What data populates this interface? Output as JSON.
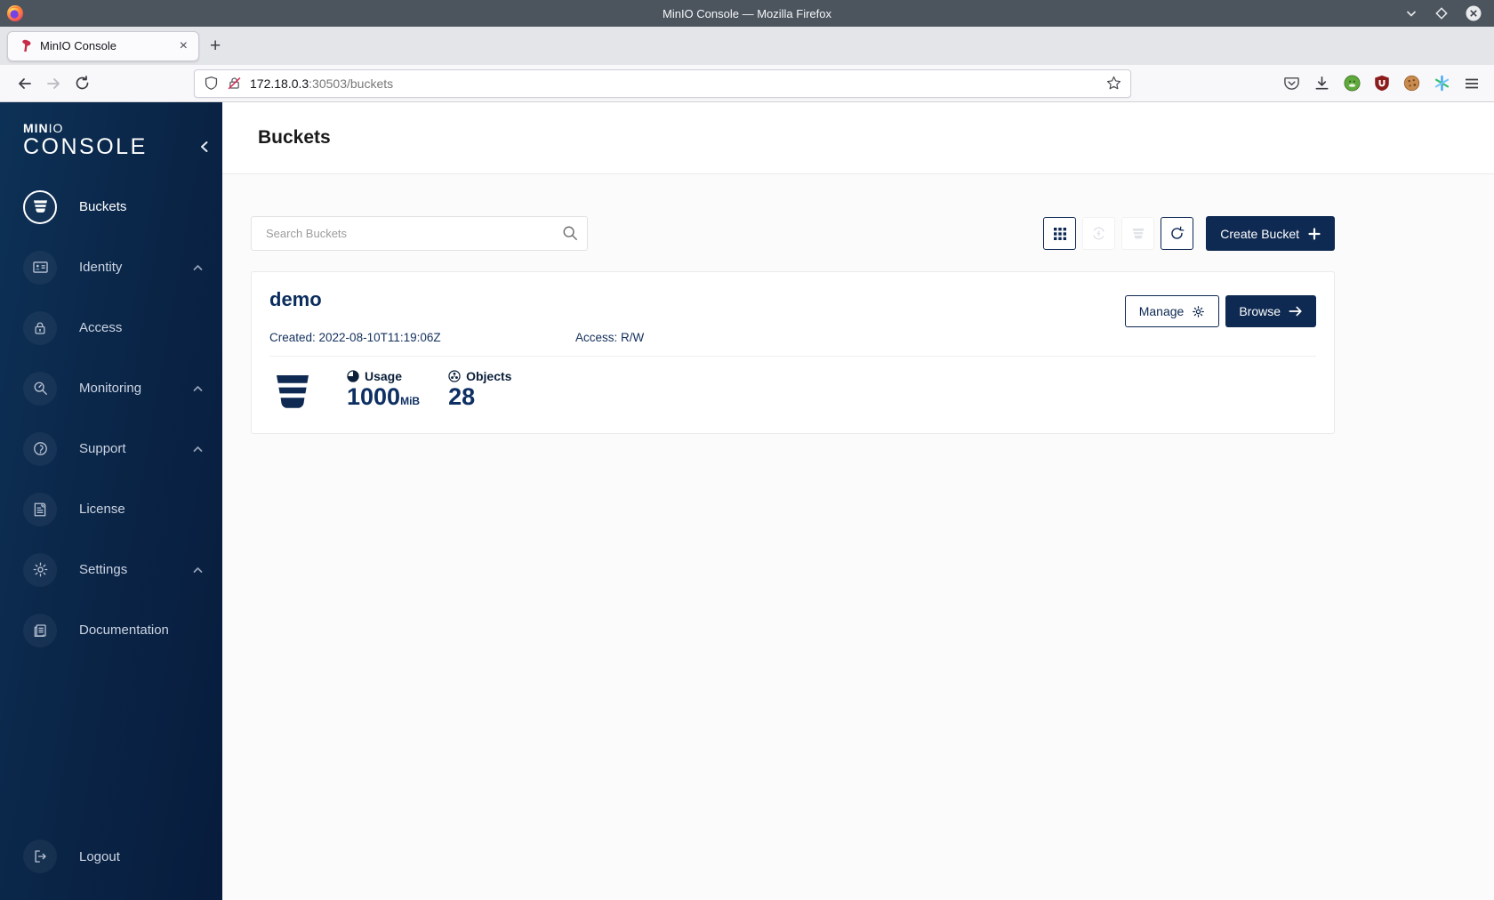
{
  "window": {
    "title": "MinIO Console — Mozilla Firefox"
  },
  "tab": {
    "title": "MinIO Console",
    "close_glyph": "×",
    "new_tab_glyph": "+"
  },
  "urlbar": {
    "host": "172.18.0.3",
    "path": ":30503/buckets"
  },
  "sidebar": {
    "brand": {
      "bold": "MIN",
      "light": "IO",
      "sub": "CONSOLE"
    },
    "items": [
      {
        "label": "Buckets",
        "active": true,
        "caret": false
      },
      {
        "label": "Identity",
        "active": false,
        "caret": true
      },
      {
        "label": "Access",
        "active": false,
        "caret": false
      },
      {
        "label": "Monitoring",
        "active": false,
        "caret": true
      },
      {
        "label": "Support",
        "active": false,
        "caret": true
      },
      {
        "label": "License",
        "active": false,
        "caret": false
      },
      {
        "label": "Settings",
        "active": false,
        "caret": true
      },
      {
        "label": "Documentation",
        "active": false,
        "caret": false
      }
    ],
    "logout": {
      "label": "Logout"
    }
  },
  "page": {
    "title": "Buckets"
  },
  "search": {
    "placeholder": "Search Buckets"
  },
  "actions": {
    "create": "Create Bucket"
  },
  "card": {
    "name": "demo",
    "created": "Created: 2022-08-10T11:19:06Z",
    "access": "Access: R/W",
    "manage": "Manage",
    "browse": "Browse",
    "usage_label": "Usage",
    "usage_value": "1000",
    "usage_unit": "MiB",
    "objects_label": "Objects",
    "objects_value": "28"
  },
  "colors": {
    "navy_primary": "#0e2a52",
    "sidebar_gradient_from": "#0d3156",
    "sidebar_gradient_to": "#081c3d",
    "link_navy": "#0b2d5e",
    "titlebar_gray": "#4c555e",
    "minio_red": "#c72e49",
    "content_bg": "#fbfbfb"
  },
  "icons": {
    "firefox-logo": "fox-circle",
    "minio-favicon": "red flamingo glyph",
    "shield-icon": "tracking-protection shield",
    "lock-slash-icon": "insecure padlock with red slash",
    "star-icon": "bookmark star ☆",
    "pocket-icon": "pocket badge",
    "download-icon": "down arrow into tray",
    "privacy-badger-icon": "green circle",
    "ublock-icon": "dark red shield",
    "cookie-icon": "brown cookie",
    "container-icon": "multicolor asterisk",
    "menu-icon": "hamburger ≡",
    "bucket-icon": "striped bucket",
    "identity-icon": "id card",
    "access-icon": "padlock",
    "monitoring-icon": "magnifier gauge",
    "support-icon": "diagnostic wrench circle",
    "license-icon": "document with seal",
    "settings-icon": "gear",
    "documentation-icon": "stacked pages",
    "logout-icon": "exit door arrow",
    "grid-view-icon": "3x3 grid",
    "replicate-icon": "circular arrows bolt",
    "delete-bucket-icon": "bucket glyph",
    "refresh-icon": "circular arrow ↻",
    "plus-icon": "+",
    "gear-icon": "⚙",
    "arrow-right-icon": "→",
    "search-icon": "magnifier",
    "usage-pie-icon": "three-quarter pie",
    "objects-icon": "trefoil circle",
    "chevron-up-icon": "^",
    "collapse-icon": "‹"
  }
}
